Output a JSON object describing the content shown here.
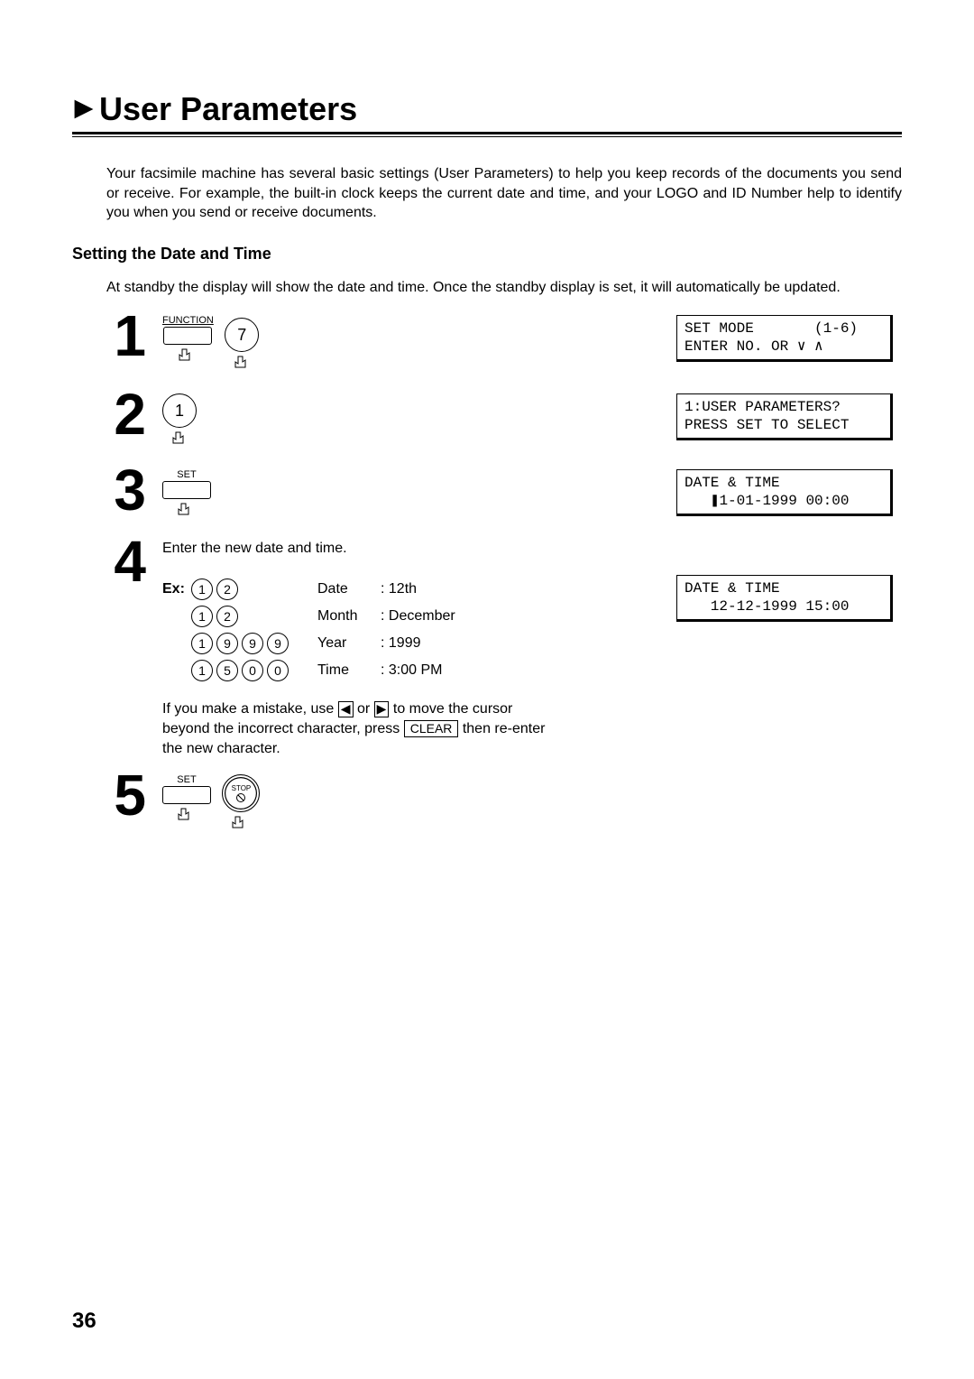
{
  "title": "User Parameters",
  "intro": "Your facsimile machine has several basic settings (User Parameters) to help you keep records of the documents you send or receive.  For example, the built-in clock keeps the current date and time, and your LOGO and ID Number help to identify you when you send or receive documents.",
  "subheading": "Setting the Date and Time",
  "subintro": "At standby the display will show the date and time.  Once the standby display is set, it will automatically be updated.",
  "steps": {
    "s1": {
      "num": "1",
      "function_label": "FUNCTION",
      "key": "7",
      "display_l1": "SET MODE       (1-6)",
      "display_l2": "ENTER NO. OR ∨ ∧"
    },
    "s2": {
      "num": "2",
      "key": "1",
      "display_l1": "1:USER PARAMETERS?",
      "display_l2": "PRESS SET TO SELECT"
    },
    "s3": {
      "num": "3",
      "set_label": "SET",
      "display_l1": "DATE & TIME",
      "display_l2": "   ❚1-01-1999 00:00"
    },
    "s4": {
      "num": "4",
      "instr": "Enter the new date and time.",
      "ex_label": "Ex:",
      "rows": [
        {
          "keys": [
            "1",
            "2"
          ],
          "label": "Date",
          "value": ": 12th"
        },
        {
          "keys": [
            "1",
            "2"
          ],
          "label": "Month",
          "value": ": December"
        },
        {
          "keys": [
            "1",
            "9",
            "9",
            "9"
          ],
          "label": "Year",
          "value": ": 1999"
        },
        {
          "keys": [
            "1",
            "5",
            "0",
            "0"
          ],
          "label": "Time",
          "value": ": 3:00 PM"
        }
      ],
      "display_l1": "DATE & TIME",
      "display_l2": "   12-12-1999 15:00",
      "note_before": "If you make a mistake, use ",
      "note_mid1": " or ",
      "note_mid2": " to move the cursor beyond the incorrect character, press ",
      "clear_label": "CLEAR",
      "note_after": " then re-enter the new character."
    },
    "s5": {
      "num": "5",
      "set_label": "SET",
      "stop_label": "STOP"
    }
  },
  "page_number": "36"
}
